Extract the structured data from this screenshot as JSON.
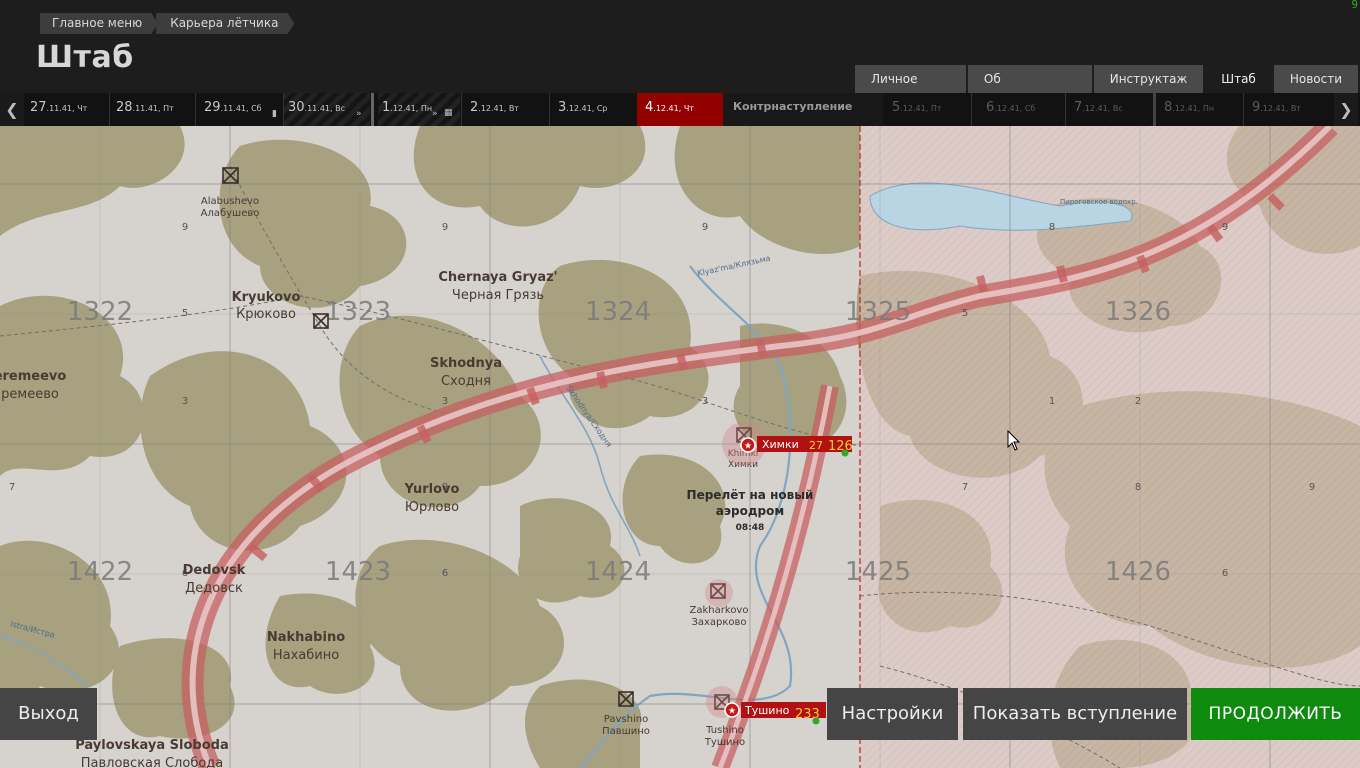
{
  "breadcrumbs": [
    "Главное меню",
    "Карьера лётчика"
  ],
  "page_title": "Штаб",
  "fps_counter": "9",
  "tabs": [
    {
      "label": "Личное дело",
      "active": false
    },
    {
      "label": "Об эскадрилье",
      "active": false
    },
    {
      "label": "Инструктаж",
      "active": false
    },
    {
      "label": "Штаб",
      "active": true
    },
    {
      "label": "Новости",
      "active": false
    }
  ],
  "timeline": {
    "days": [
      {
        "num": "27",
        "date": ".11.41, Чт"
      },
      {
        "num": "28",
        "date": ".11.41, Пт"
      },
      {
        "num": "29",
        "date": ".11.41, Сб"
      },
      {
        "num": "30",
        "date": ".11.41, Вс"
      },
      {
        "num": "1",
        "date": ".12.41, Пн"
      },
      {
        "num": "2",
        "date": ".12.41, Вт"
      },
      {
        "num": "3",
        "date": ".12.41, Ср"
      },
      {
        "num": "4",
        "date": ".12.41, Чт"
      },
      {
        "num": "5",
        "date": ".12.41, Пт"
      },
      {
        "num": "6",
        "date": ".12.41, Сб"
      },
      {
        "num": "7",
        "date": ".12.41, Вс"
      },
      {
        "num": "8",
        "date": ".12.41, Пн"
      },
      {
        "num": "9",
        "date": ".12.41, Вт"
      }
    ],
    "selected_index": 7,
    "event_label": "Контрнаступление"
  },
  "map": {
    "grid_squares": [
      "1322",
      "1323",
      "1324",
      "1325",
      "1326",
      "1422",
      "1423",
      "1424",
      "1425",
      "1426"
    ],
    "subgrid_digits": [
      "1",
      "2",
      "3",
      "4",
      "5",
      "6",
      "7",
      "8",
      "9"
    ],
    "towns": [
      {
        "en": "Alabushevo",
        "ru": "Алабушево"
      },
      {
        "en": "Kryukovo",
        "ru": "Крюково"
      },
      {
        "en": "Chernaya Gryaz'",
        "ru": "Черная Грязь"
      },
      {
        "en": "Skhodnya",
        "ru": "Сходня"
      },
      {
        "en": "eremeevo",
        "ru": "ремеево"
      },
      {
        "en": "Yurlovo",
        "ru": "Юрлово"
      },
      {
        "en": "Dedovsk",
        "ru": "Дедовск"
      },
      {
        "en": "Nakhabino",
        "ru": "Нахабино"
      },
      {
        "en": "Khimki",
        "ru": "Химки"
      },
      {
        "en": "Zakharkovo",
        "ru": "Захарково"
      },
      {
        "en": "Pavshino",
        "ru": "Павшино"
      },
      {
        "en": "Tushino",
        "ru": "Тушино"
      },
      {
        "en": "Paylovskaya Sloboda",
        "ru": "Павловская Слобода"
      }
    ],
    "rivers": [
      {
        "label": "Klyaz'ma/Клязьма"
      },
      {
        "label": "Istra/Истра"
      },
      {
        "label": "Skhodnya/Сходня"
      }
    ],
    "reservoir_label": "Пироговское водохр.",
    "airfields": [
      {
        "name": "Химки",
        "num1": "27",
        "num2": "126"
      },
      {
        "name": "Тушино",
        "num1": "233",
        "num2": ""
      }
    ],
    "event_note": {
      "line1": "Перелёт на новый",
      "line2": "аэродром",
      "time": "08:48"
    },
    "colors": {
      "forest": "#a6a07f",
      "open": "#d7d3cf",
      "front": "#c04848",
      "enemy_tint": "#e0c4bf"
    }
  },
  "buttons": {
    "exit": "Выход",
    "settings": "Настройки",
    "intro": "Показать вступление",
    "continue": "ПРОДОЛЖИТЬ"
  }
}
